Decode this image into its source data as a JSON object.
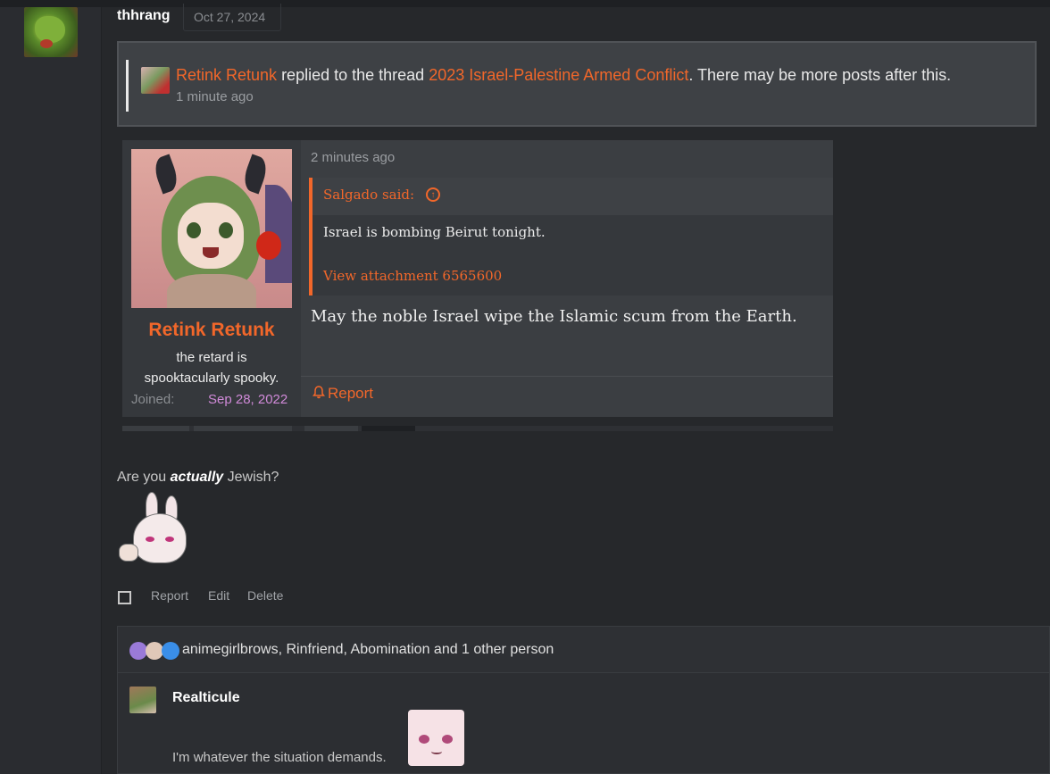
{
  "post": {
    "username": "thhrang",
    "date": "Oct 27, 2024"
  },
  "notice": {
    "actor": "Retink Retunk",
    "verb": " replied to the thread ",
    "thread": "2023 Israel-Palestine Armed Conflict",
    "suffix": ". There may be more posts after this.",
    "time": "1 minute ago"
  },
  "quoted_post": {
    "author": "Retink Retunk",
    "user_title_line1": "the retard is",
    "user_title_line2": "spooktacularly spooky.",
    "joined_label": "Joined:",
    "joined_value": "Sep 28, 2022",
    "time": "2 minutes ago",
    "quote": {
      "author_label": "Salgado said:",
      "text": "Israel is bombing Beirut tonight.",
      "attachment_link": "View attachment 6565600"
    },
    "body": "May the noble Israel wipe the Islamic scum from the Earth.",
    "report_label": "Report"
  },
  "reply": {
    "text_before": "Are you ",
    "text_emphasis": "actually",
    "text_after": " Jewish?"
  },
  "actions": {
    "report": "Report",
    "edit": "Edit",
    "delete": "Delete"
  },
  "reactions": {
    "summary": "animegirlbrows, Rinfriend, Abomination and 1 other person"
  },
  "comment": {
    "author": "Realticule",
    "text": "I'm whatever the situation demands."
  },
  "colors": {
    "accent": "#f2672a",
    "background": "#26282b",
    "joined_date": "#d08ad8"
  }
}
